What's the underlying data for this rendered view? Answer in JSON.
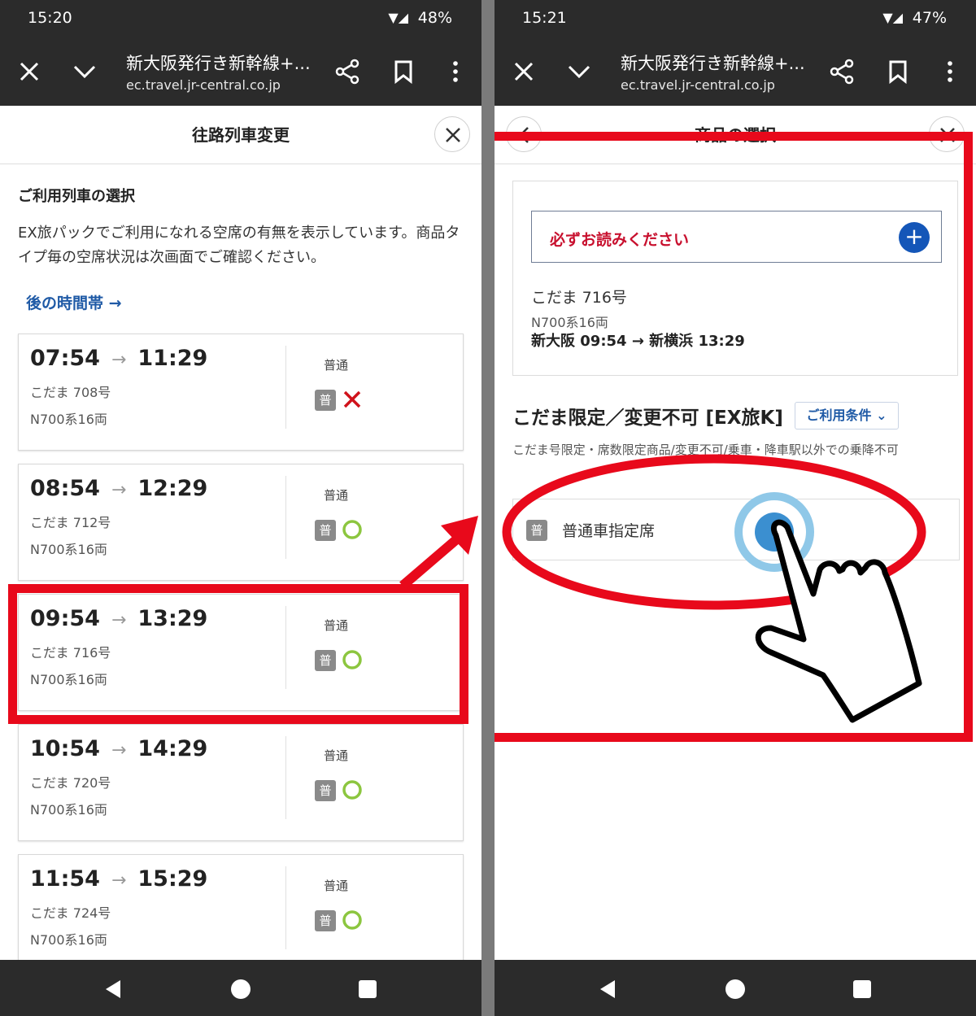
{
  "left": {
    "status": {
      "time": "15:20",
      "battery": "48%"
    },
    "toolbar": {
      "title": "新大阪発行き新幹線+...",
      "url": "ec.travel.jr-central.co.jp"
    },
    "modal_title": "往路列車変更",
    "section_title": "ご利用列車の選択",
    "description": "EX旅パックでご利用になれる空席の有無を表示しています。商品タイプ毎の空席状況は次画面でご確認ください。",
    "later_link": "後の時間帯 →",
    "trains": [
      {
        "dep": "07:54",
        "arr": "11:29",
        "name": "こだま 708号",
        "model": "N700系16両",
        "class": "普通",
        "badge": "普",
        "available": false
      },
      {
        "dep": "08:54",
        "arr": "12:29",
        "name": "こだま 712号",
        "model": "N700系16両",
        "class": "普通",
        "badge": "普",
        "available": true
      },
      {
        "dep": "09:54",
        "arr": "13:29",
        "name": "こだま 716号",
        "model": "N700系16両",
        "class": "普通",
        "badge": "普",
        "available": true
      },
      {
        "dep": "10:54",
        "arr": "14:29",
        "name": "こだま 720号",
        "model": "N700系16両",
        "class": "普通",
        "badge": "普",
        "available": true
      },
      {
        "dep": "11:54",
        "arr": "15:29",
        "name": "こだま 724号",
        "model": "N700系16両",
        "class": "普通",
        "badge": "普",
        "available": true
      }
    ]
  },
  "right": {
    "status": {
      "time": "15:21",
      "battery": "47%"
    },
    "toolbar": {
      "title": "新大阪発行き新幹線+...",
      "url": "ec.travel.jr-central.co.jp"
    },
    "modal_title": "商品の選択",
    "must_read": "必ずお読みください",
    "train_name": "こだま 716号",
    "train_model": "N700系16両",
    "route": "新大阪 09:54 → 新横浜 13:29",
    "product_title": "こだま限定／変更不可 [EX旅K]",
    "conditions_button": "ご利用条件",
    "product_desc": "こだま号限定・席数限定商品/変更不可/乗車・降車駅以外での乗降不可",
    "seat_badge": "普",
    "seat_label": "普通車指定席"
  },
  "colors": {
    "highlight": "#e8091b",
    "link": "#1f5aa6",
    "unavailable": "#d0121b",
    "available": "#8cc63f",
    "bar": "#2b2b2b"
  }
}
